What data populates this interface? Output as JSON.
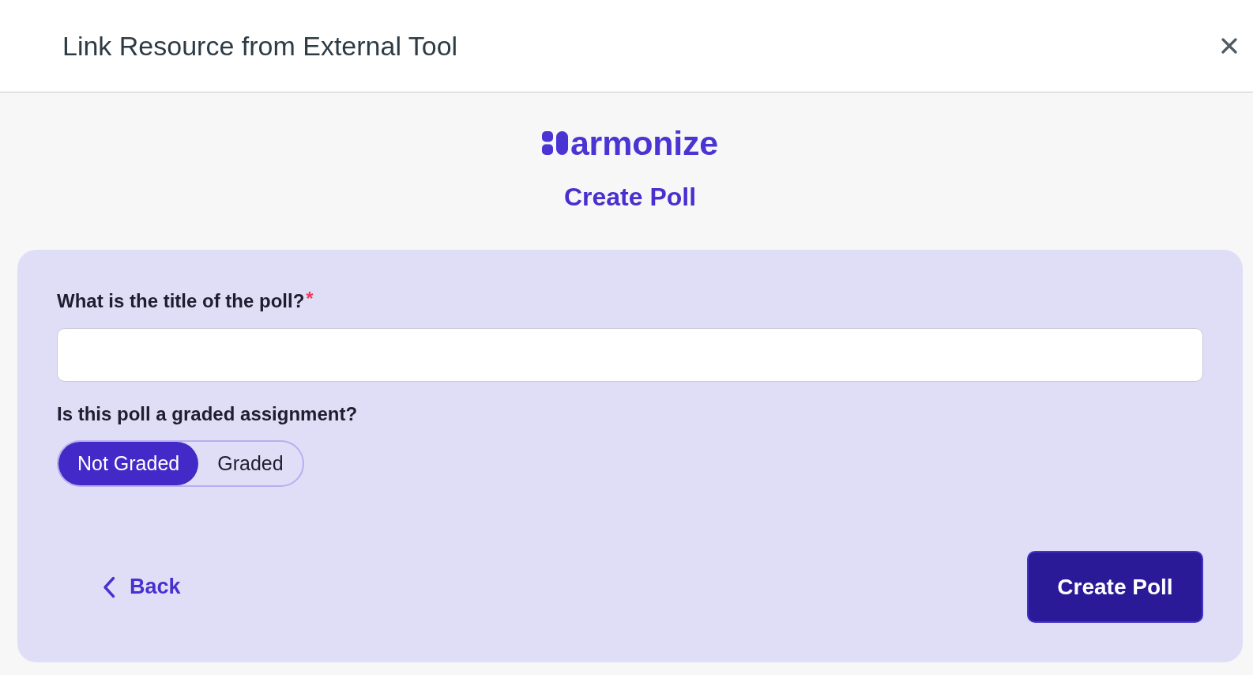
{
  "dialog": {
    "title": "Link Resource from External Tool"
  },
  "brand": {
    "wordmark": "armonize"
  },
  "heading": "Create Poll",
  "form": {
    "title_field": {
      "label": "What is the title of the poll?",
      "required": true,
      "required_mark": "*"
    },
    "grading": {
      "label": "Is this poll a graded assignment?",
      "options": [
        {
          "label": "Not Graded",
          "selected": true
        },
        {
          "label": "Graded",
          "selected": false
        }
      ]
    }
  },
  "actions": {
    "back": "Back",
    "submit": "Create Poll"
  }
}
